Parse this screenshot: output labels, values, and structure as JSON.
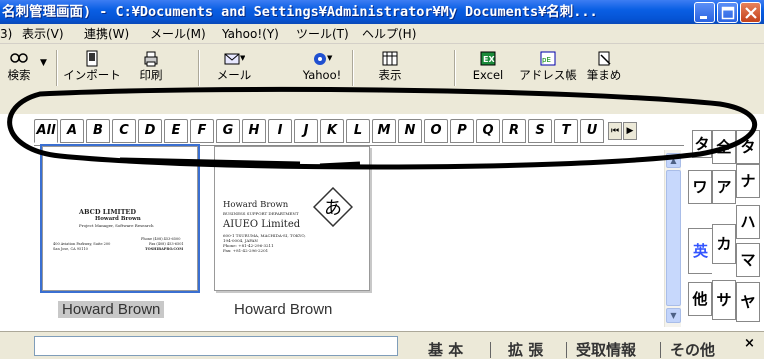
{
  "window": {
    "title": "名刺管理画面) - C:¥Documents and Settings¥Administrator¥My Documents¥名刺..."
  },
  "menubar": {
    "items": [
      "3)",
      "表示(V)",
      "連携(W)",
      "メール(M)",
      "Yahoo!(Y)",
      "ツール(T)",
      "ヘルプ(H)"
    ]
  },
  "toolbar": {
    "buttons": [
      {
        "label": "検索",
        "icon": "search-icon"
      },
      {
        "label": "インポート",
        "icon": "import-icon"
      },
      {
        "label": "印刷",
        "icon": "print-icon"
      },
      {
        "label": "メール",
        "icon": "mail-icon"
      },
      {
        "label": "Yahoo!",
        "icon": "yahoo-icon"
      },
      {
        "label": "表示",
        "icon": "view-icon"
      },
      {
        "label": "Excel",
        "icon": "excel-icon"
      },
      {
        "label": "アドレス帳",
        "icon": "addressbook-icon"
      },
      {
        "label": "筆まめ",
        "icon": "fudemame-icon"
      }
    ]
  },
  "alpha_tabs": [
    "All",
    "A",
    "B",
    "C",
    "D",
    "E",
    "F",
    "G",
    "H",
    "I",
    "J",
    "K",
    "L",
    "M",
    "N",
    "O",
    "P",
    "Q",
    "R",
    "S",
    "T",
    "U"
  ],
  "alpha_nav": [
    "⏮",
    "▶"
  ],
  "cards": [
    {
      "caption": "Howard Brown",
      "company": "ABCD LIMITED",
      "name": "Howard Brown",
      "title": "Project Manager, Software Research",
      "address1": "400 Aviation Parkway, Suite 200",
      "address2": "San Jose, CA 95110",
      "phone": "Phone (408) 453-6500",
      "fax": "Fax (408) 453-6501",
      "web": "TOSHIBAPRO.COM"
    },
    {
      "caption": "Howard Brown",
      "name": "Howard Brown",
      "dept": "BUSINESS SUPPORT DEPARTMENT",
      "company": "AIUEO Limited",
      "addr1": "600-1 TSURUMA, MACHIDA-SI, TOKYO,",
      "addr2": "194-0004, JAPAN",
      "phone": "Phone: +81-42-296-3211",
      "fax": "Fax: +81-42-296-2201",
      "logo": "あ"
    }
  ],
  "kana_tabs": [
    "タ",
    "全",
    "ナ",
    "ア",
    "ワ",
    "ハ",
    "カ",
    "英",
    "マ",
    "サ",
    "他",
    "ヤ"
  ],
  "bottom_tabs": [
    "基 本",
    "拡 張",
    "受取情報",
    "その他"
  ],
  "colors": {
    "titlebar": "#0553d4",
    "selection": "#3a6fd1",
    "english_tab": "#3355ff"
  }
}
